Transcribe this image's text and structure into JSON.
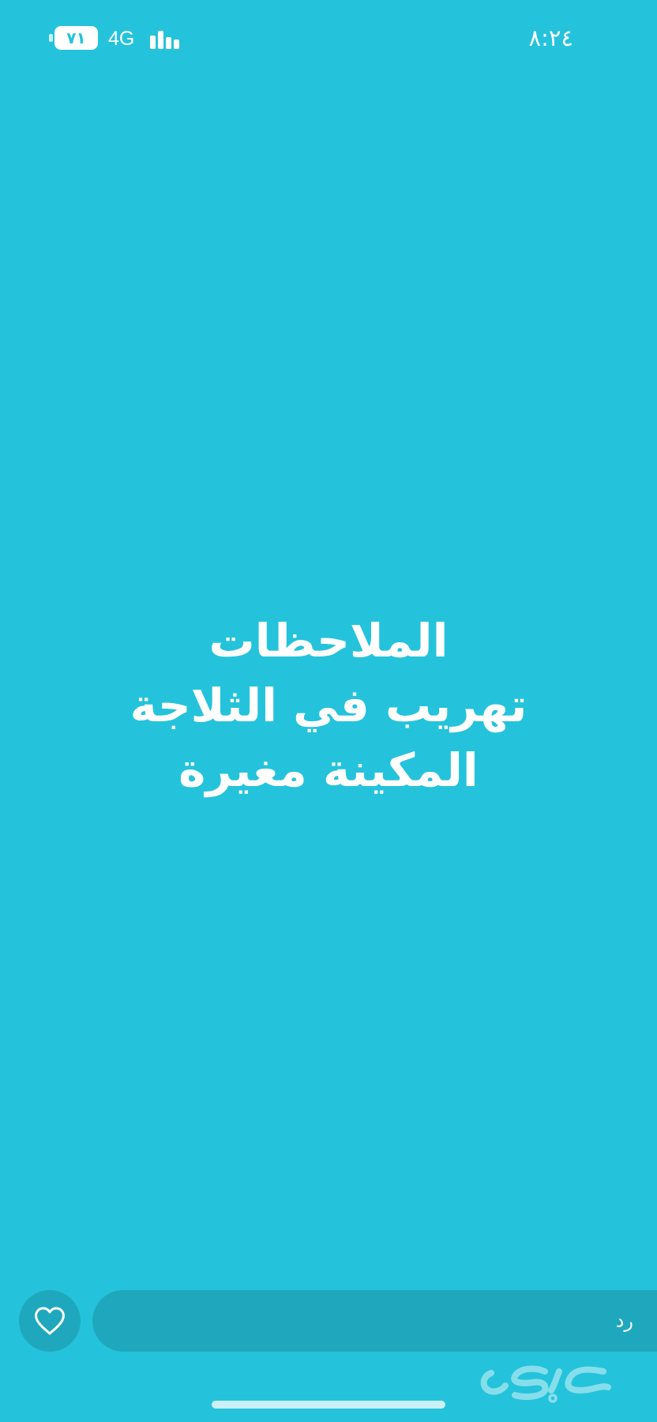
{
  "status_bar": {
    "time": "٨:٢٤",
    "battery_text": "٧١",
    "battery_level": 0.71,
    "network": "4G",
    "battery_icon": "battery-icon",
    "signal_icon": "signal-bars-icon"
  },
  "post": {
    "background_color": "#24c3db",
    "lines": [
      "الملاحظات",
      "تهريب في الثلاجة",
      "المكينة مغيرة"
    ]
  },
  "footer": {
    "like_icon": "heart-icon",
    "reply_placeholder": "رد",
    "watermark_text": "حراج"
  }
}
